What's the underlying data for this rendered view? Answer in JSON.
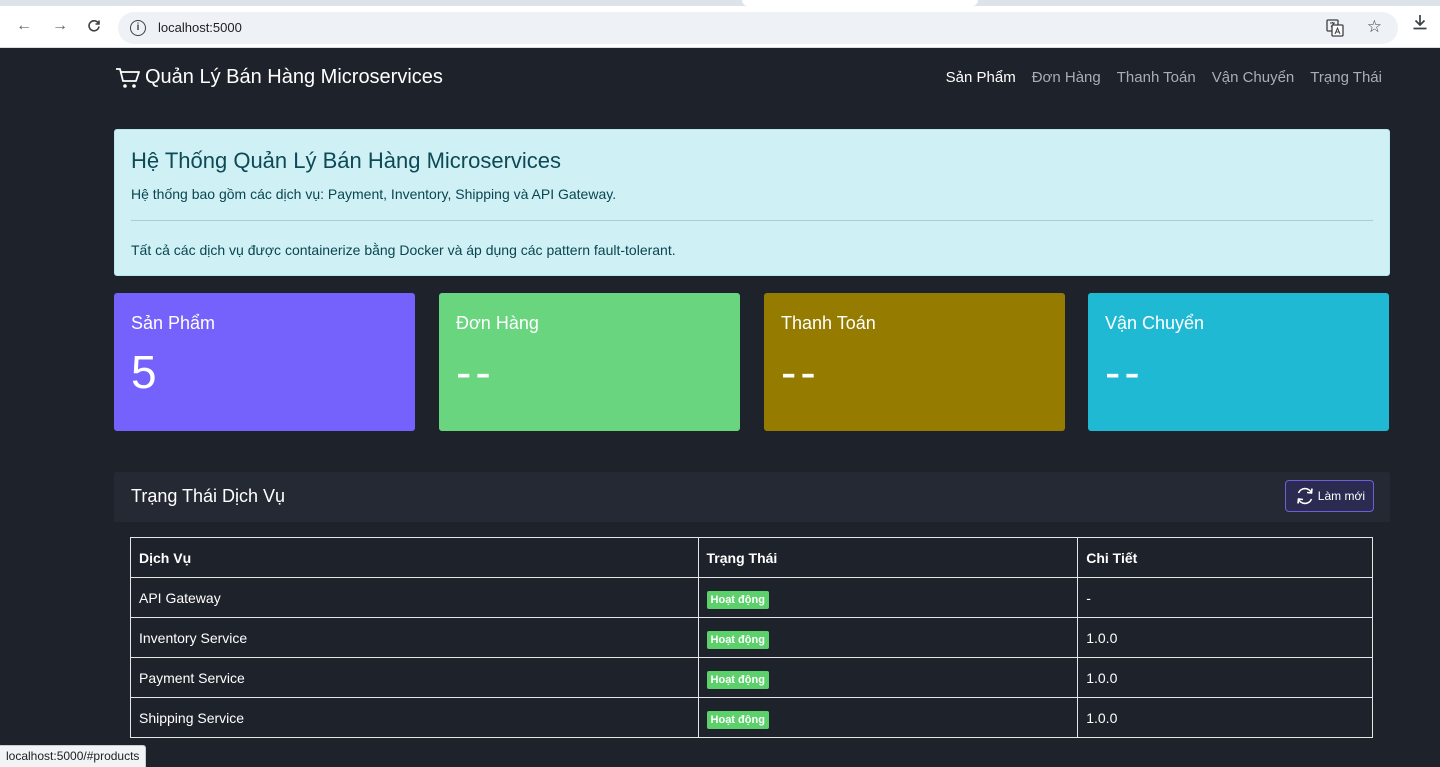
{
  "browser": {
    "url": "localhost:5000",
    "status_url": "localhost:5000/#products"
  },
  "navbar": {
    "brand": "Quản Lý Bán Hàng Microservices",
    "links": [
      {
        "label": "Sản Phẩm",
        "active": true
      },
      {
        "label": "Đơn Hàng",
        "active": false
      },
      {
        "label": "Thanh Toán",
        "active": false
      },
      {
        "label": "Vận Chuyển",
        "active": false
      },
      {
        "label": "Trạng Thái",
        "active": false
      }
    ]
  },
  "alert": {
    "heading": "Hệ Thống Quản Lý Bán Hàng Microservices",
    "line1": "Hệ thống bao gồm các dịch vụ: Payment, Inventory, Shipping và API Gateway.",
    "line2": "Tất cả các dịch vụ được containerize bằng Docker và áp dụng các pattern fault-tolerant."
  },
  "cards": {
    "products": {
      "title": "Sản Phẩm",
      "value": "5",
      "color": "#7561fb"
    },
    "orders": {
      "title": "Đơn Hàng",
      "value": "--",
      "color": "#6ad57f"
    },
    "payments": {
      "title": "Thanh Toán",
      "value": "--",
      "color": "#957c00"
    },
    "shipping": {
      "title": "Vận Chuyển",
      "value": "--",
      "color": "#20b9d3"
    }
  },
  "services": {
    "title": "Trạng Thái Dịch Vụ",
    "refresh_label": "Làm mới",
    "columns": [
      "Dịch Vụ",
      "Trạng Thái",
      "Chi Tiết"
    ],
    "rows": [
      {
        "name": "API Gateway",
        "status": "Hoạt động",
        "detail": "-"
      },
      {
        "name": "Inventory Service",
        "status": "Hoạt động",
        "detail": "1.0.0"
      },
      {
        "name": "Payment Service",
        "status": "Hoạt động",
        "detail": "1.0.0"
      },
      {
        "name": "Shipping Service",
        "status": "Hoạt động",
        "detail": "1.0.0"
      }
    ]
  },
  "colors": {
    "page_bg": "#1e222b",
    "alert_bg": "#cff1f6",
    "badge_success": "#5cd06a",
    "refresh_border": "#6f5fd6"
  }
}
